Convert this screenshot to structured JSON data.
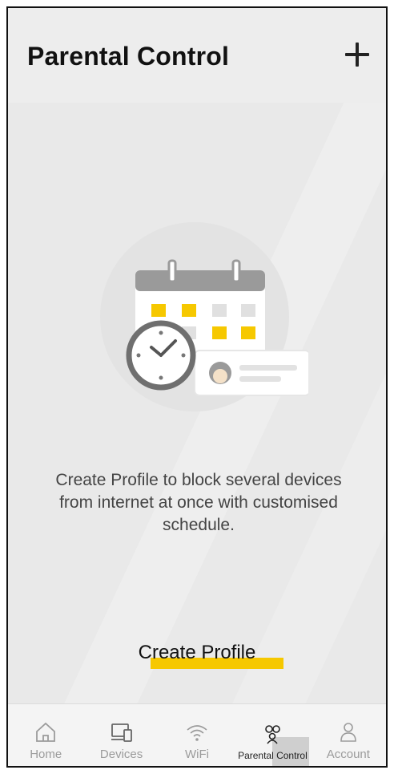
{
  "header": {
    "title": "Parental Control",
    "add_icon": "plus-icon"
  },
  "empty_state": {
    "illustration": "calendar-clock-profile-illustration",
    "message": "Create Profile to block several devices from internet at once with customised schedule.",
    "cta_label": "Create Profile"
  },
  "tabs": [
    {
      "label": "Home",
      "icon": "home-icon",
      "active": false
    },
    {
      "label": "Devices",
      "icon": "devices-icon",
      "active": false
    },
    {
      "label": "WiFi",
      "icon": "wifi-icon",
      "active": false
    },
    {
      "label": "Parental Control",
      "icon": "parental-control-icon",
      "active": true
    },
    {
      "label": "Account",
      "icon": "account-icon",
      "active": false
    }
  ],
  "colors": {
    "accent": "#f6c800",
    "background": "#e9e9e9",
    "title": "#111111"
  }
}
